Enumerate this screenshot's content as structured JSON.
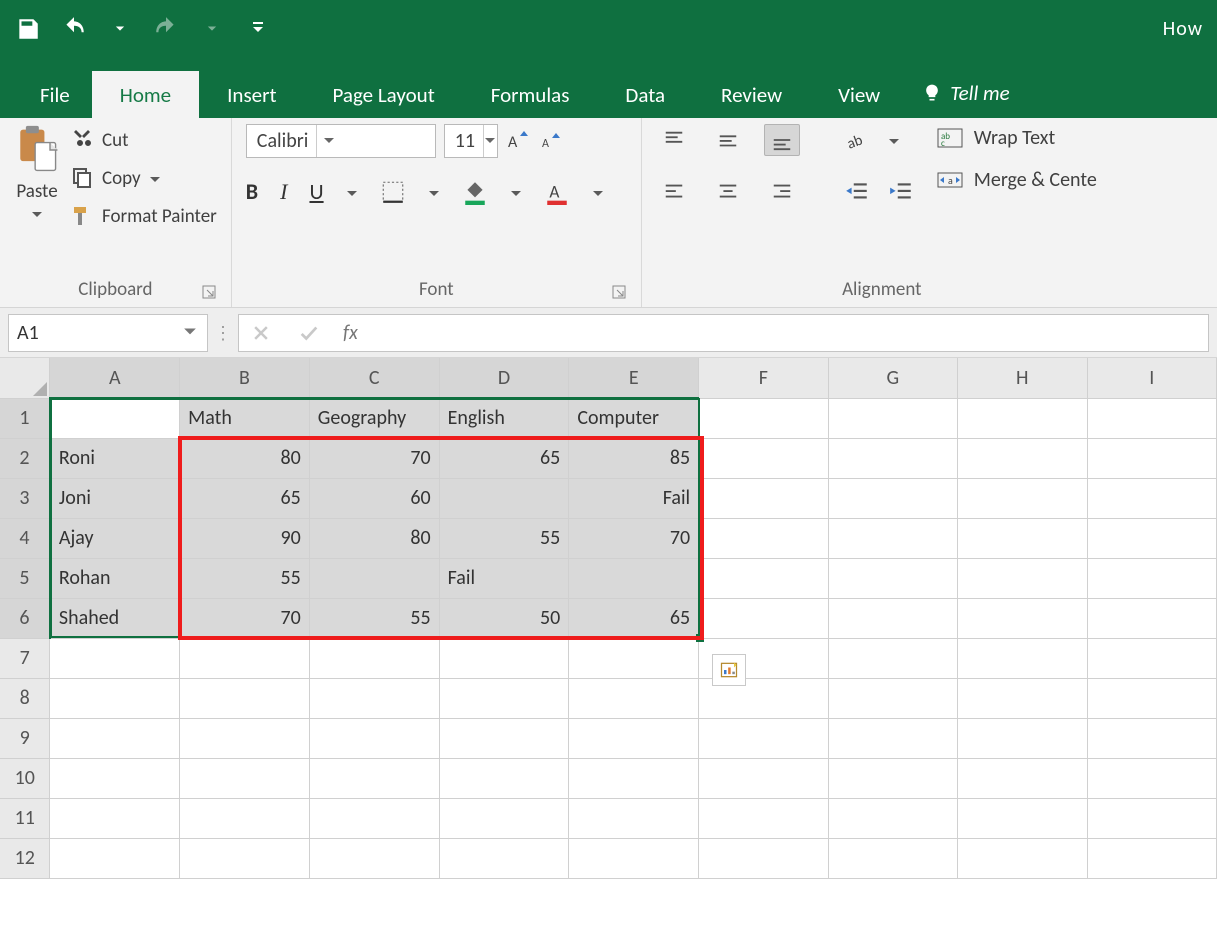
{
  "titlebar": {
    "app_title": "How"
  },
  "tabs": {
    "file": "File",
    "home": "Home",
    "insert": "Insert",
    "pagelayout": "Page Layout",
    "formulas": "Formulas",
    "data": "Data",
    "review": "Review",
    "view": "View",
    "tellme": "Tell me"
  },
  "ribbon": {
    "clipboard": {
      "paste": "Paste",
      "cut": "Cut",
      "copy": "Copy",
      "formatpainter": "Format Painter",
      "group_label": "Clipboard"
    },
    "font": {
      "fontname": "Calibri",
      "fontsize": "11",
      "bold": "B",
      "italic": "I",
      "underline": "U",
      "group_label": "Font"
    },
    "alignment": {
      "wrap": "Wrap Text",
      "merge": "Merge & Cente",
      "group_label": "Alignment"
    }
  },
  "fx": {
    "namebox": "A1",
    "fx_label": "fx",
    "formula": ""
  },
  "grid": {
    "columns": [
      "A",
      "B",
      "C",
      "D",
      "E",
      "F",
      "G",
      "H",
      "I"
    ],
    "rows": [
      "1",
      "2",
      "3",
      "4",
      "5",
      "6",
      "7",
      "8",
      "9",
      "10",
      "11",
      "12"
    ],
    "headers": {
      "B1": "Math",
      "C1": "Geography",
      "D1": "English",
      "E1": "Computer"
    },
    "data": [
      {
        "name": "Roni",
        "B": "80",
        "C": "70",
        "D": "65",
        "E": "85"
      },
      {
        "name": "Joni",
        "B": "65",
        "C": "60",
        "D": "",
        "E": "Fail"
      },
      {
        "name": "Ajay",
        "B": "90",
        "C": "80",
        "D": "55",
        "E": "70"
      },
      {
        "name": "Rohan",
        "B": "55",
        "C": "",
        "D": "Fail",
        "E": ""
      },
      {
        "name": "Shahed",
        "B": "70",
        "C": "55",
        "D": "50",
        "E": "65"
      }
    ]
  }
}
